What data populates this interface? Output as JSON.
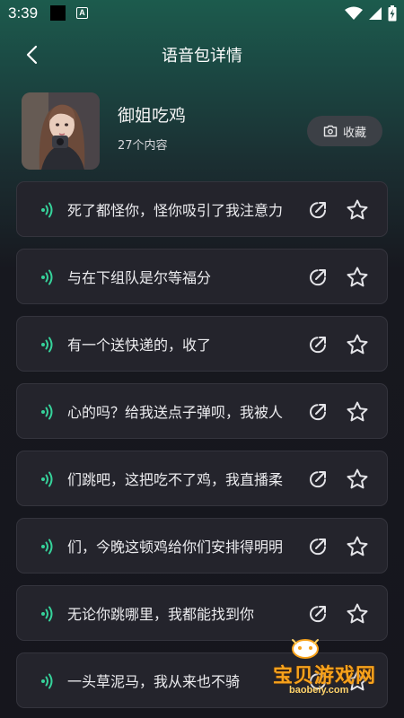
{
  "status_bar": {
    "time": "3:39",
    "notification_letter": "A",
    "icons": [
      "wifi-icon",
      "signal-icon",
      "battery-charging-icon"
    ]
  },
  "header": {
    "title": "语音包详情",
    "back_icon": "chevron-left-icon"
  },
  "pack": {
    "name": "御姐吃鸡",
    "count": "27个内容",
    "favorite_label": "收藏",
    "favorite_icon": "camera-folder-icon"
  },
  "items": [
    {
      "text": "死了都怪你，怪你吸引了我注意力"
    },
    {
      "text": "与在下组队是尔等福分"
    },
    {
      "text": "有一个送快递的，收了"
    },
    {
      "text": "心的吗？给我送点子弹呗，我被人"
    },
    {
      "text": "们跳吧，这把吃不了鸡，我直播柔"
    },
    {
      "text": "们，今晚这顿鸡给你们安排得明明"
    },
    {
      "text": "无论你跳哪里，我都能找到你"
    },
    {
      "text": "一头草泥马，我从来也不骑"
    }
  ],
  "item_icons": {
    "play": "sound-wave-icon",
    "share": "share-icon",
    "favorite": "star-icon"
  },
  "watermark": {
    "brand": "宝贝游戏网",
    "url": "baobeiy.com"
  },
  "colors": {
    "accent_green": "#36d39b",
    "background": "#17171f",
    "card": "#24242c",
    "watermark": "#f7a21b"
  }
}
